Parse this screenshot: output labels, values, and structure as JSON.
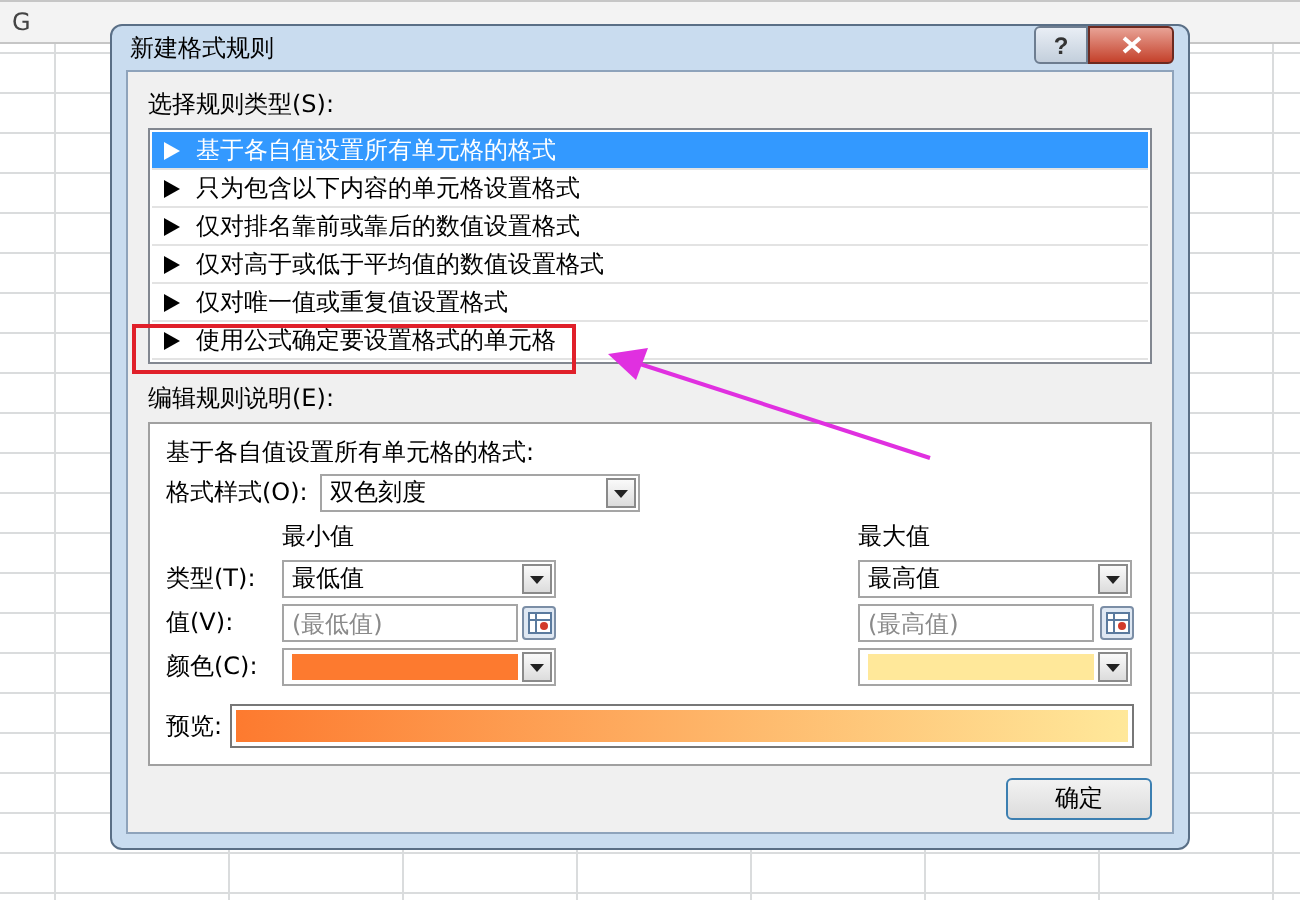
{
  "sheet": {
    "column_header": "G"
  },
  "window": {
    "title": "新建格式规则",
    "help_button": "?"
  },
  "rule_type": {
    "label": "选择规则类型(S):",
    "items": [
      {
        "label": "基于各自值设置所有单元格的格式",
        "selected": true
      },
      {
        "label": "只为包含以下内容的单元格设置格式",
        "selected": false
      },
      {
        "label": "仅对排名靠前或靠后的数值设置格式",
        "selected": false
      },
      {
        "label": "仅对高于或低于平均值的数值设置格式",
        "selected": false
      },
      {
        "label": "仅对唯一值或重复值设置格式",
        "selected": false
      },
      {
        "label": "使用公式确定要设置格式的单元格",
        "selected": false
      }
    ]
  },
  "edit": {
    "label": "编辑规则说明(E):",
    "description": "基于各自值设置所有单元格的格式:",
    "format_style": {
      "label": "格式样式(O):",
      "value": "双色刻度"
    },
    "row_labels": {
      "type_label": "类型(T):",
      "value_label": "值(V):",
      "color_label": "颜色(C):"
    },
    "min": {
      "heading": "最小值",
      "type": "最低值",
      "placeholder": "(最低值)",
      "color": "#fd7a2f"
    },
    "max": {
      "heading": "最大值",
      "type": "最高值",
      "placeholder": "(最高值)",
      "color": "#ffe89a"
    },
    "preview_label": "预览:"
  },
  "buttons": [
    "确定"
  ]
}
